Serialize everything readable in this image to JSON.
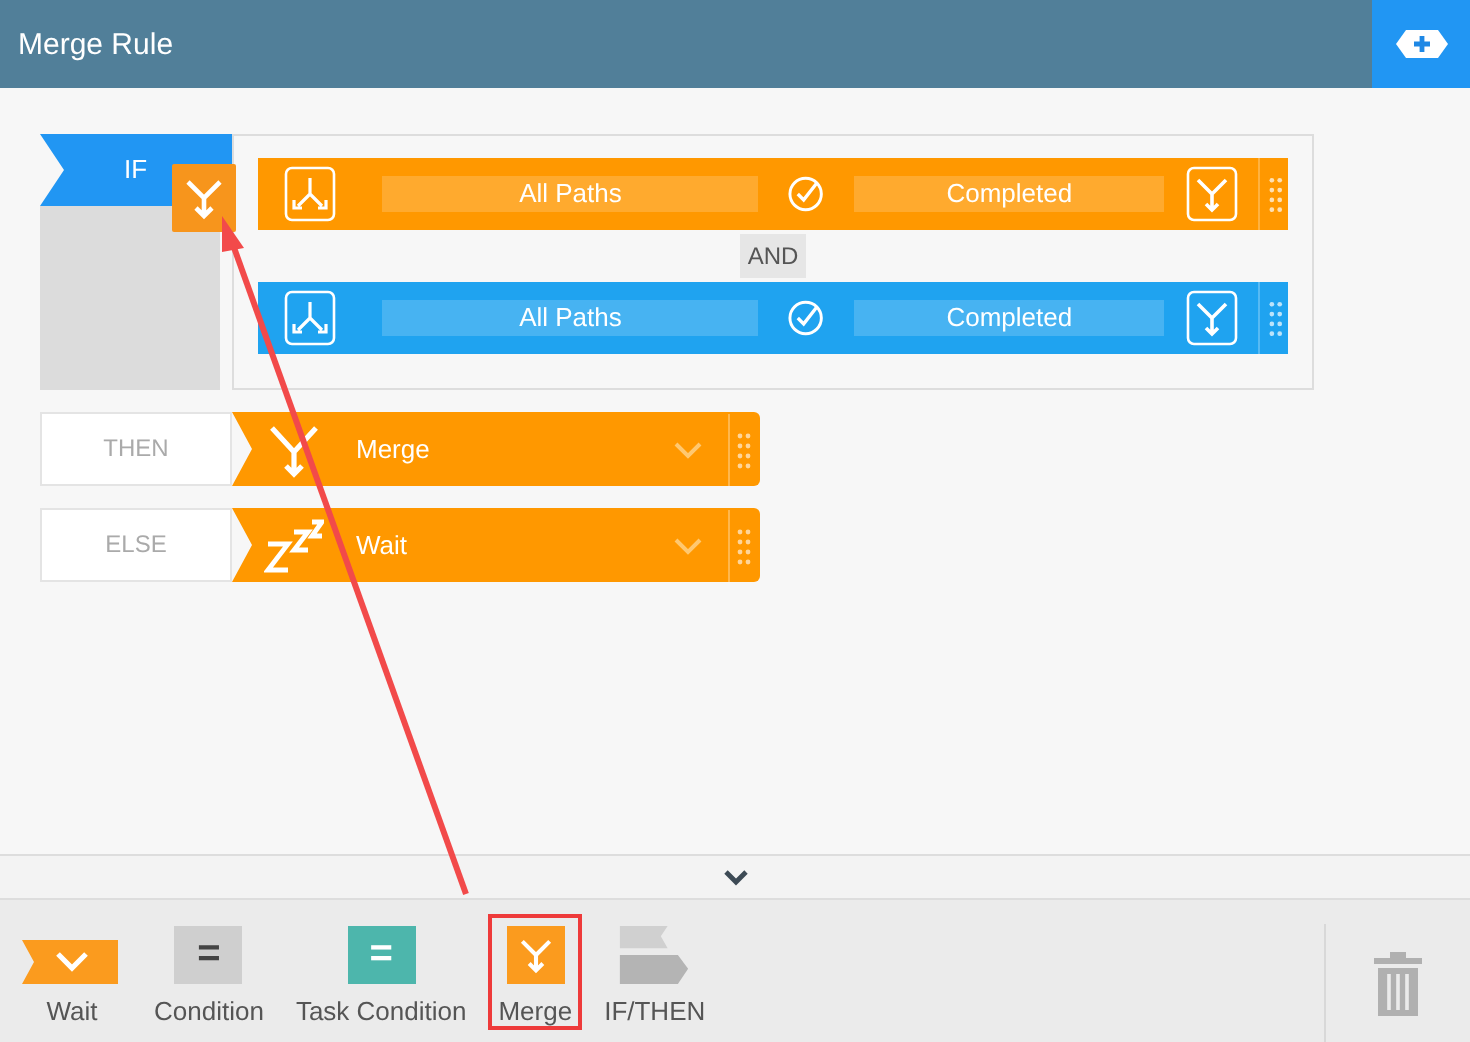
{
  "window": {
    "title": "Merge Rule"
  },
  "if_label": "IF",
  "conditions": [
    {
      "path": "All Paths",
      "status": "Completed",
      "color": "#ff9800"
    },
    {
      "path": "All Paths",
      "status": "Completed",
      "color": "#1fa3f0"
    }
  ],
  "joiner": "AND",
  "branches": [
    {
      "label": "THEN",
      "kind": "merge",
      "action": "Merge"
    },
    {
      "label": "ELSE",
      "kind": "wait",
      "action": "Wait"
    }
  ],
  "palette": [
    {
      "kind": "wait",
      "label": "Wait",
      "selected": false
    },
    {
      "kind": "condition",
      "label": "Condition",
      "glyph": "=",
      "selected": false
    },
    {
      "kind": "task",
      "label": "Task Condition",
      "glyph": "=",
      "selected": false
    },
    {
      "kind": "merge",
      "label": "Merge",
      "selected": true
    },
    {
      "kind": "ifthen",
      "label": "IF/THEN",
      "selected": false
    }
  ]
}
